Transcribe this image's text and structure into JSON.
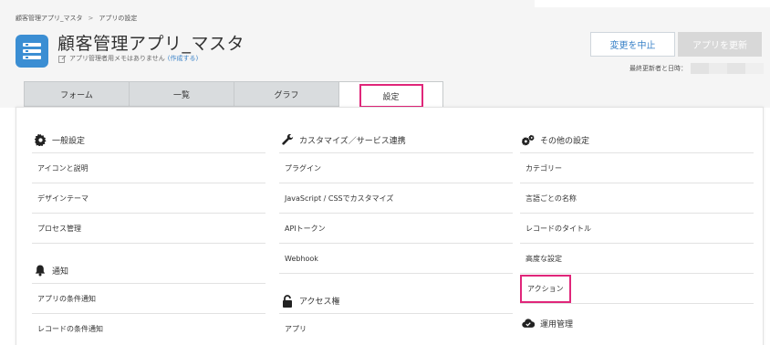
{
  "breadcrumb": {
    "items": [
      "顧客管理アプリ_マスタ",
      "アプリの設定"
    ],
    "separator": ">"
  },
  "app": {
    "title": "顧客管理アプリ_マスタ",
    "memo_text": "アプリ管理者用メモはありません",
    "memo_link": "(作成する)",
    "icon": "list-icon",
    "icon_color": "#3b8ed3"
  },
  "header": {
    "cancel_label": "変更を中止",
    "update_label": "アプリを更新",
    "last_updated_label": "最終更新者と日時："
  },
  "tabs": [
    {
      "label": "フォーム",
      "active": false
    },
    {
      "label": "一覧",
      "active": false
    },
    {
      "label": "グラフ",
      "active": false
    },
    {
      "label": "設定",
      "active": true
    }
  ],
  "columns": {
    "general": {
      "title": "一般設定",
      "icon": "gear-icon",
      "items": [
        "アイコンと説明",
        "デザインテーマ",
        "プロセス管理"
      ]
    },
    "notifications": {
      "title": "通知",
      "icon": "bell-icon",
      "items": [
        "アプリの条件通知",
        "レコードの条件通知"
      ]
    },
    "customize": {
      "title": "カスタマイズ／サービス連携",
      "icon": "wrench-icon",
      "items": [
        "プラグイン",
        "JavaScript / CSSでカスタマイズ",
        "APIトークン",
        "Webhook"
      ]
    },
    "access": {
      "title": "アクセス権",
      "icon": "lock-icon",
      "items": [
        "アプリ"
      ]
    },
    "other": {
      "title": "その他の設定",
      "icon": "gears-icon",
      "items": [
        "カテゴリー",
        "言語ごとの名称",
        "レコードのタイトル",
        "高度な設定",
        "アクション"
      ]
    },
    "operations": {
      "title": "運用管理",
      "icon": "cloud-icon"
    }
  },
  "colors": {
    "highlight": "#e0267a",
    "link": "#3a82c8",
    "tab_bg": "#d9dcde"
  }
}
